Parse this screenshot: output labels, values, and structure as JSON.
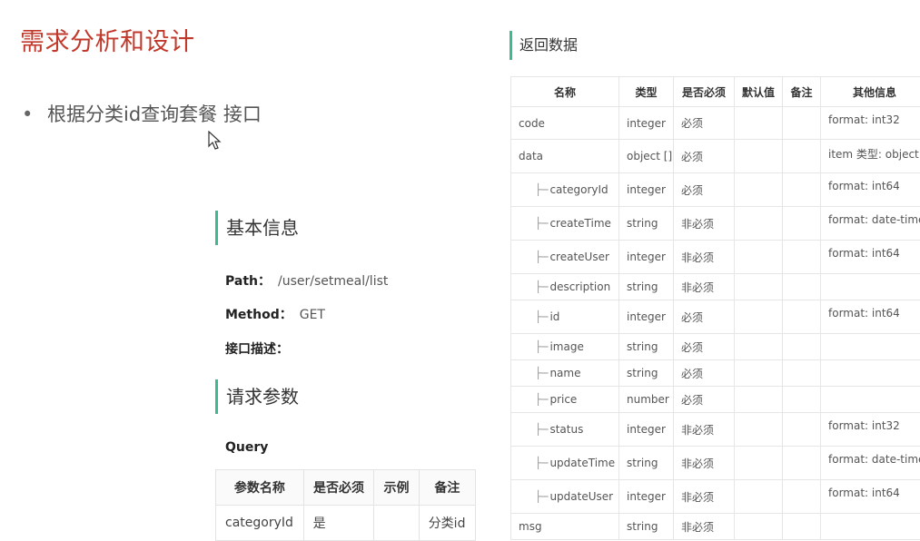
{
  "slide": {
    "title": "需求分析和设计",
    "bullet": "根据分类id查询套餐 接口"
  },
  "basic_info": {
    "heading": "基本信息",
    "path_label": "Path：",
    "path_value": "/user/setmeal/list",
    "method_label": "Method：",
    "method_value": "GET",
    "desc_label": "接口描述："
  },
  "request_params": {
    "heading": "请求参数",
    "query_label": "Query",
    "columns": [
      "参数名称",
      "是否必须",
      "示例",
      "备注"
    ],
    "rows": [
      [
        "categoryId",
        "是",
        "",
        "分类id"
      ]
    ]
  },
  "return_data": {
    "heading": "返回数据",
    "columns": [
      "名称",
      "类型",
      "是否必须",
      "默认值",
      "备注",
      "其他信息"
    ],
    "tree_prefix": "├─",
    "rows": [
      {
        "name": "code",
        "child": false,
        "type": "integer",
        "required": "必须",
        "default": "",
        "note": "",
        "other": "format: int32"
      },
      {
        "name": "data",
        "child": false,
        "type": "object []",
        "required": "必须",
        "default": "",
        "note": "",
        "other": "item 类型: object"
      },
      {
        "name": "categoryId",
        "child": true,
        "type": "integer",
        "required": "必须",
        "default": "",
        "note": "",
        "other": "format: int64"
      },
      {
        "name": "createTime",
        "child": true,
        "type": "string",
        "required": "非必须",
        "default": "",
        "note": "",
        "other": "format: date-time"
      },
      {
        "name": "createUser",
        "child": true,
        "type": "integer",
        "required": "非必须",
        "default": "",
        "note": "",
        "other": "format: int64"
      },
      {
        "name": "description",
        "child": true,
        "type": "string",
        "required": "非必须",
        "default": "",
        "note": "",
        "other": ""
      },
      {
        "name": "id",
        "child": true,
        "type": "integer",
        "required": "必须",
        "default": "",
        "note": "",
        "other": "format: int64"
      },
      {
        "name": "image",
        "child": true,
        "type": "string",
        "required": "必须",
        "default": "",
        "note": "",
        "other": ""
      },
      {
        "name": "name",
        "child": true,
        "type": "string",
        "required": "必须",
        "default": "",
        "note": "",
        "other": ""
      },
      {
        "name": "price",
        "child": true,
        "type": "number",
        "required": "必须",
        "default": "",
        "note": "",
        "other": ""
      },
      {
        "name": "status",
        "child": true,
        "type": "integer",
        "required": "非必须",
        "default": "",
        "note": "",
        "other": "format: int32"
      },
      {
        "name": "updateTime",
        "child": true,
        "type": "string",
        "required": "非必须",
        "default": "",
        "note": "",
        "other": "format: date-time"
      },
      {
        "name": "updateUser",
        "child": true,
        "type": "integer",
        "required": "非必须",
        "default": "",
        "note": "",
        "other": "format: int64"
      },
      {
        "name": "msg",
        "child": false,
        "type": "string",
        "required": "非必须",
        "default": "",
        "note": "",
        "other": ""
      }
    ]
  },
  "colors": {
    "title": "#c0392b",
    "accent_bar": "#3fba8e"
  }
}
